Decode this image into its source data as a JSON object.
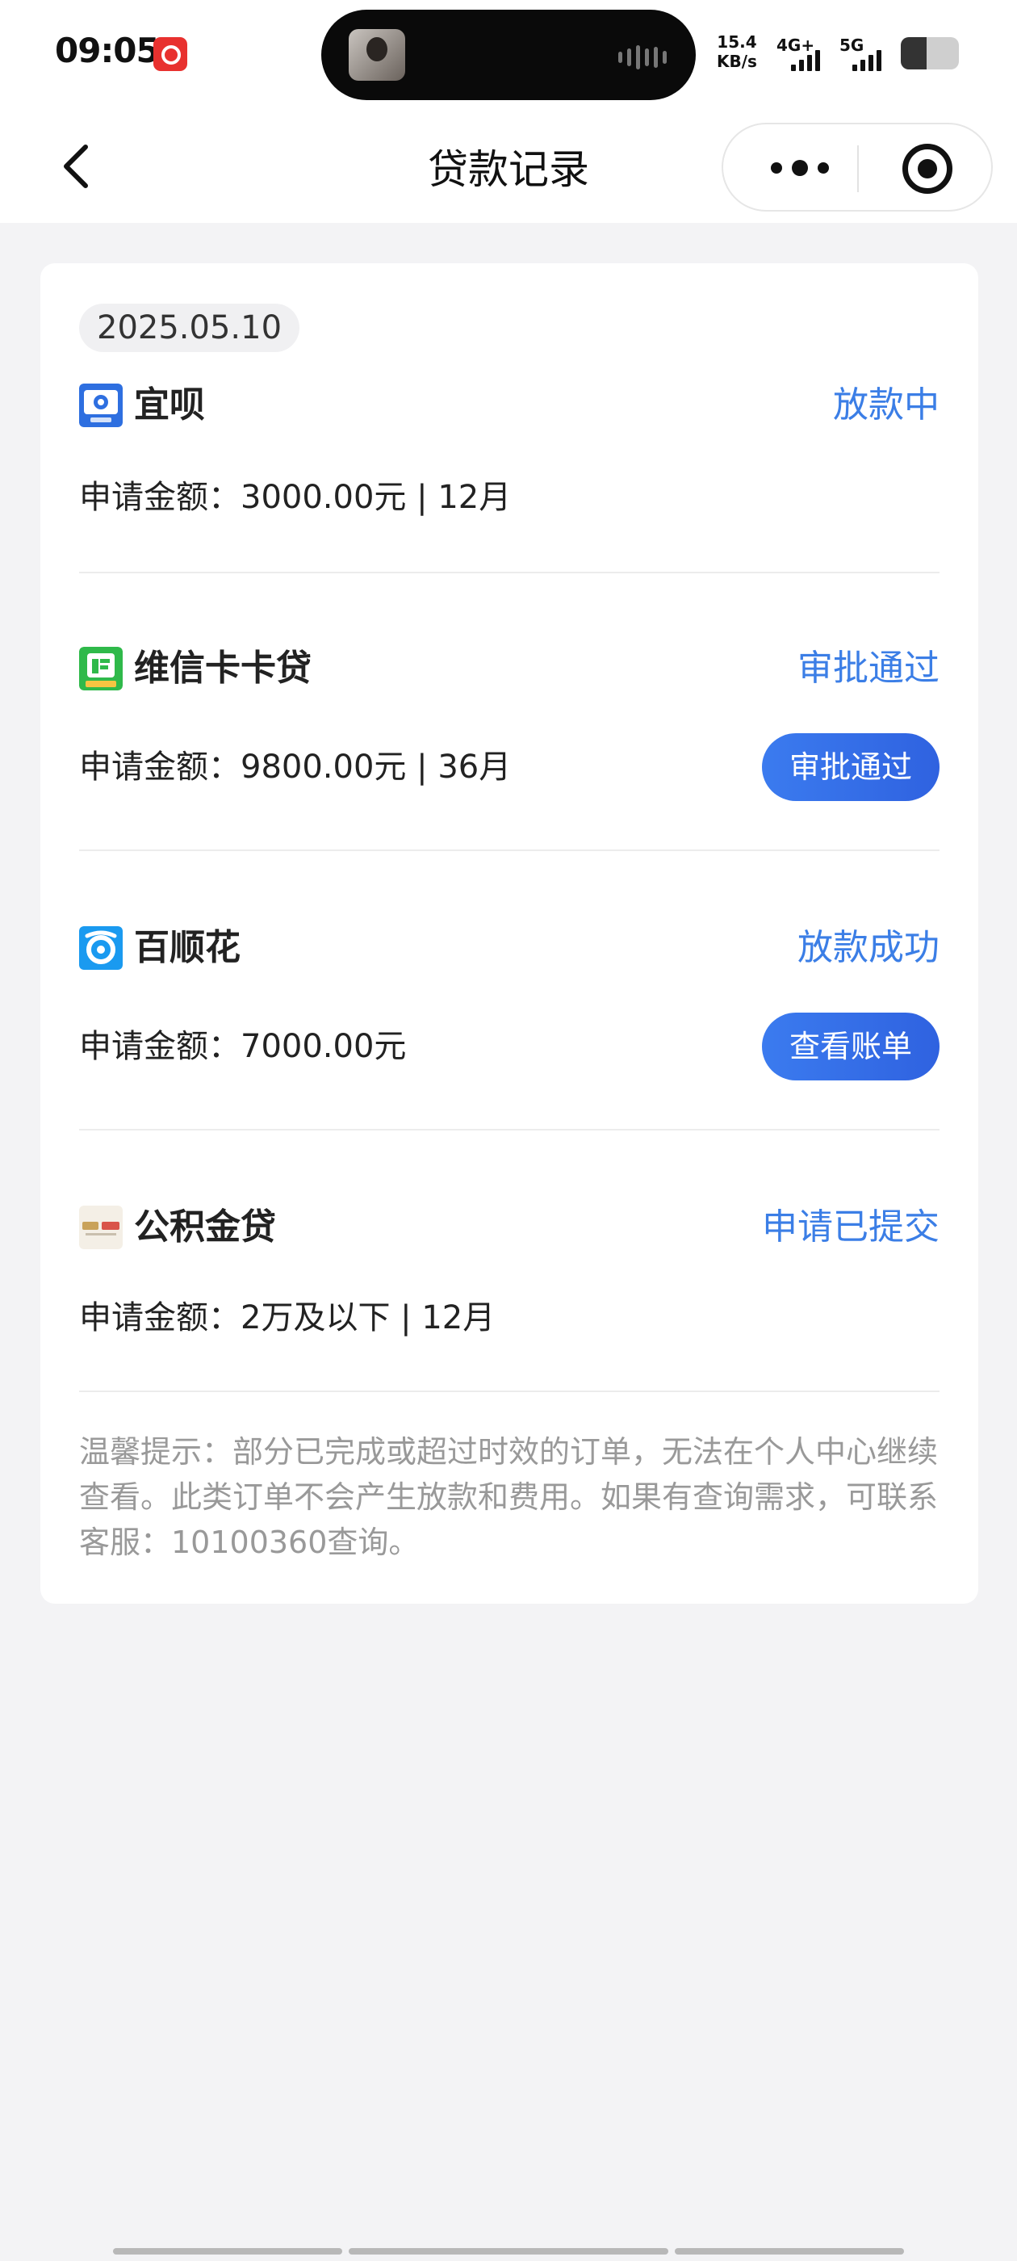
{
  "status_bar": {
    "time": "09:05",
    "net_speed_value": "15.4",
    "net_speed_unit": "KB/s",
    "signal_1": "4G+",
    "signal_2": "5G",
    "battery_level": 0.45
  },
  "nav": {
    "title": "贷款记录"
  },
  "records": {
    "date": "2025.05.10",
    "items": [
      {
        "name": "宜呗",
        "status": "放款中",
        "amount": "申请金额：3000.00元 | 12月",
        "logo_color": "#2e6fe0",
        "button": ""
      },
      {
        "name": "维信卡卡贷",
        "status": "审批通过",
        "amount": "申请金额：9800.00元 | 36月",
        "logo_color": "#2fb94a",
        "button": "审批通过"
      },
      {
        "name": "百顺花",
        "status": "放款成功",
        "amount": "申请金额：7000.00元",
        "logo_color": "#1a9af0",
        "button": "查看账单"
      },
      {
        "name": "公积金贷",
        "status": "申请已提交",
        "amount": "申请金额：2万及以下 | 12月",
        "logo_color": "#f4efe6",
        "button": ""
      }
    ]
  },
  "tip": "温馨提示：部分已完成或超过时效的订单，无法在个人中心继续查看。此类订单不会产生放款和费用。如果有查询需求，可联系客服：10100360查询。",
  "colors": {
    "accent": "#3b7ee6",
    "button": "#2f62e0",
    "background": "#f3f3f5"
  }
}
